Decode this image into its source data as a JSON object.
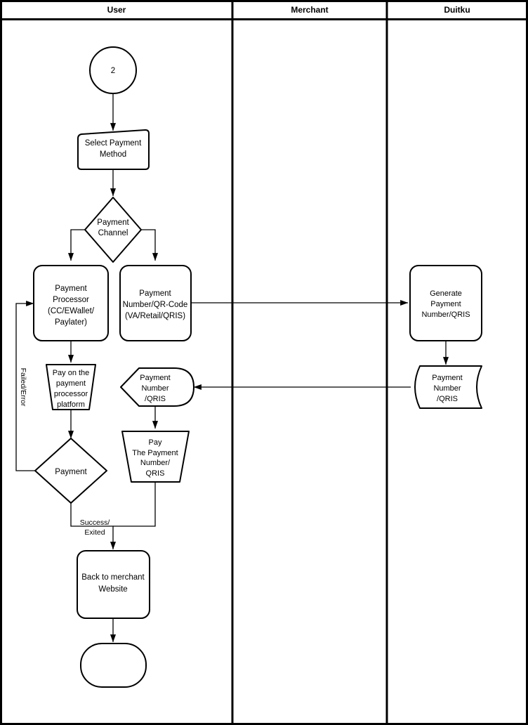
{
  "diagram": {
    "title": "Payment flow swimlane diagram",
    "background": "#ffffff",
    "stroke_color": "#000000",
    "fill_color": "#ffffff"
  },
  "lanes": [
    {
      "id": "user",
      "label": "User"
    },
    {
      "id": "merchant",
      "label": "Merchant"
    },
    {
      "id": "duitku",
      "label": "Duitku"
    }
  ],
  "nodes": {
    "start_connector": {
      "shape": "circle",
      "label": "2"
    },
    "select_payment_method": {
      "shape": "card",
      "line1": "Select Payment",
      "line2": "Method"
    },
    "payment_channel": {
      "shape": "decision",
      "line1": "Payment",
      "line2": "Channel"
    },
    "payment_processor": {
      "shape": "process",
      "line1": "Payment",
      "line2": "Processor",
      "line3": "(CC/EWallet/",
      "line4": "Paylater)"
    },
    "payment_number_qr_code": {
      "shape": "process",
      "line1": "Payment",
      "line2": "Number/QR-Code",
      "line3": "(VA/Retail/QRIS)"
    },
    "pay_on_platform": {
      "shape": "manual-operation",
      "line1": "Pay on the",
      "line2": "payment",
      "line3": "processor",
      "line4": "platform"
    },
    "payment_number_qris_user": {
      "shape": "delay",
      "line1": "Payment",
      "line2": "Number",
      "line3": "/QRIS"
    },
    "pay_the_payment_number": {
      "shape": "manual-operation",
      "line1": "Pay",
      "line2": "The Payment",
      "line3": "Number/",
      "line4": "QRIS"
    },
    "payment_decision": {
      "shape": "decision",
      "line1": "Payment"
    },
    "back_to_merchant": {
      "shape": "process",
      "line1": "Back to merchant",
      "line2": "Website"
    },
    "end_terminator": {
      "shape": "terminator",
      "label": ""
    },
    "generate_payment_number": {
      "shape": "process",
      "line1": "Generate",
      "line2": "Payment",
      "line3": "Number/QRIS"
    },
    "payment_number_qris_duitku": {
      "shape": "stored-data",
      "line1": "Payment",
      "line2": "Number",
      "line3": "/QRIS"
    }
  },
  "edge_labels": {
    "failed_error": "Failed/Error",
    "success_line1": "Success/",
    "success_line2": "Exited"
  }
}
